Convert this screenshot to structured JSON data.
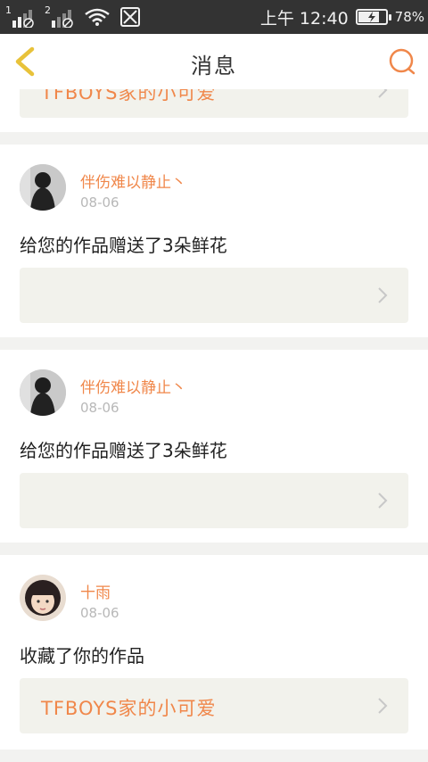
{
  "status_bar": {
    "sim1_label": "1",
    "sim2_label": "2",
    "time": "上午 12:40",
    "battery_percent": "78%",
    "battery_level": 0.78
  },
  "header": {
    "title": "消息",
    "back_icon": "chevron-left-icon",
    "search_icon": "search-icon"
  },
  "colors": {
    "accent": "#f0874a",
    "back_icon": "#e8c23a",
    "date": "#b8b8b8",
    "card_ref_bg": "#f2f2ec"
  },
  "notifications": [
    {
      "reference": "TFBOYS家的小可爱"
    },
    {
      "user": "伴伤难以静止丶",
      "date": "08-06",
      "message": "给您的作品赠送了3朵鲜花",
      "reference": ""
    },
    {
      "user": "伴伤难以静止丶",
      "date": "08-06",
      "message": "给您的作品赠送了3朵鲜花",
      "reference": ""
    },
    {
      "user": "十雨",
      "date": "08-06",
      "message": "收藏了你的作品",
      "reference": "TFBOYS家的小可爱"
    }
  ]
}
